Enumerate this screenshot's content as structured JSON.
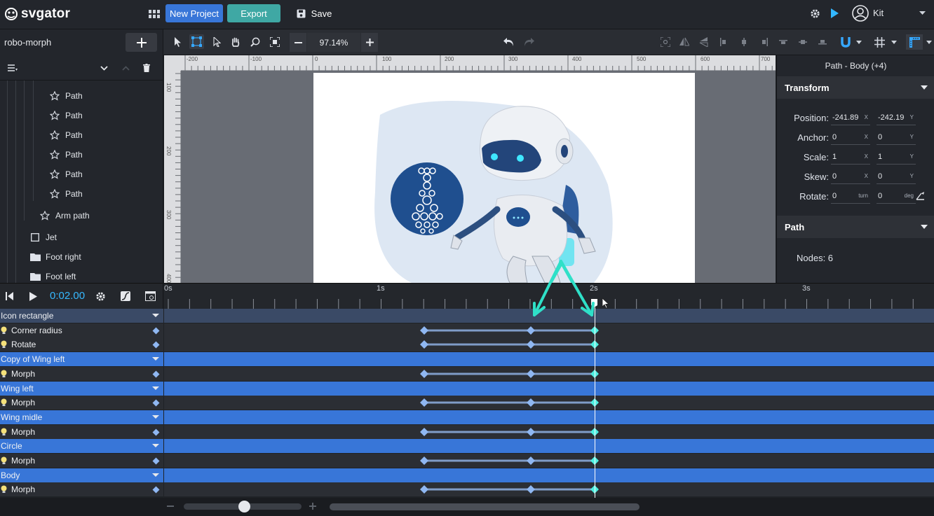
{
  "app": {
    "logo_text": "svgator",
    "new_project_label": "New Project",
    "export_label": "Export",
    "save_label": "Save",
    "user_name": "Kit"
  },
  "toolbar": {
    "zoom_value": "97.14%"
  },
  "layers": {
    "project_name": "robo-morph",
    "items": [
      {
        "label": "Path",
        "icon": "star-path-icon"
      },
      {
        "label": "Path",
        "icon": "star-path-icon"
      },
      {
        "label": "Path",
        "icon": "star-path-icon"
      },
      {
        "label": "Path",
        "icon": "star-path-icon"
      },
      {
        "label": "Path",
        "icon": "star-path-icon"
      },
      {
        "label": "Path",
        "icon": "star-path-icon"
      },
      {
        "label": "Arm path",
        "icon": "star-path-icon"
      },
      {
        "label": "Jet",
        "icon": "square-icon"
      },
      {
        "label": "Foot right",
        "icon": "folder-icon"
      },
      {
        "label": "Foot left",
        "icon": "folder-icon"
      }
    ]
  },
  "rulers": {
    "h_ticks": [
      "-200",
      "-100",
      "0",
      "100",
      "200",
      "300",
      "400",
      "500",
      "600",
      "700"
    ],
    "v_ticks": [
      "100",
      "200",
      "300",
      "400"
    ]
  },
  "inspector": {
    "title": "Path - Body (+4)",
    "transform_title": "Transform",
    "path_title": "Path",
    "position": {
      "label": "Position:",
      "x": "-241.89",
      "y": "-242.19",
      "x_unit": "X",
      "y_unit": "Y"
    },
    "anchor": {
      "label": "Anchor:",
      "x": "0",
      "y": "0",
      "x_unit": "X",
      "y_unit": "Y"
    },
    "scale": {
      "label": "Scale:",
      "x": "1",
      "y": "1",
      "x_unit": "X",
      "y_unit": "Y"
    },
    "skew": {
      "label": "Skew:",
      "x": "0",
      "y": "0",
      "x_unit": "X",
      "y_unit": "Y"
    },
    "rotate": {
      "label": "Rotate:",
      "turn": "0",
      "deg": "0",
      "turn_unit": "turn",
      "deg_unit": "deg"
    },
    "nodes": "Nodes: 6"
  },
  "timeline": {
    "current_time": "0:02.00",
    "time_labels": [
      "0s",
      "1s",
      "2s",
      "3s"
    ],
    "rows": [
      {
        "type": "group",
        "label": "Icon rectangle",
        "dark": true
      },
      {
        "type": "prop",
        "label": "Corner radius",
        "keys": 3
      },
      {
        "type": "prop",
        "label": "Rotate",
        "keys": 3
      },
      {
        "type": "group",
        "label": "Copy of Wing left"
      },
      {
        "type": "prop",
        "label": "Morph",
        "keys": 3
      },
      {
        "type": "group",
        "label": "Wing left"
      },
      {
        "type": "prop",
        "label": "Morph",
        "keys": 3
      },
      {
        "type": "group",
        "label": "Wing midle"
      },
      {
        "type": "prop",
        "label": "Morph",
        "keys": 3
      },
      {
        "type": "group",
        "label": "Circle"
      },
      {
        "type": "prop",
        "label": "Morph",
        "keys": 3
      },
      {
        "type": "group",
        "label": "Body"
      },
      {
        "type": "prop",
        "label": "Morph",
        "keys": 3
      }
    ]
  },
  "colors": {
    "accent_blue": "#3876d8",
    "export_teal": "#3fa8a4",
    "keyframe_blue": "#8fb7f2",
    "keyframe_active": "#4ff0e2",
    "arrow_teal": "#2fe0c8"
  }
}
